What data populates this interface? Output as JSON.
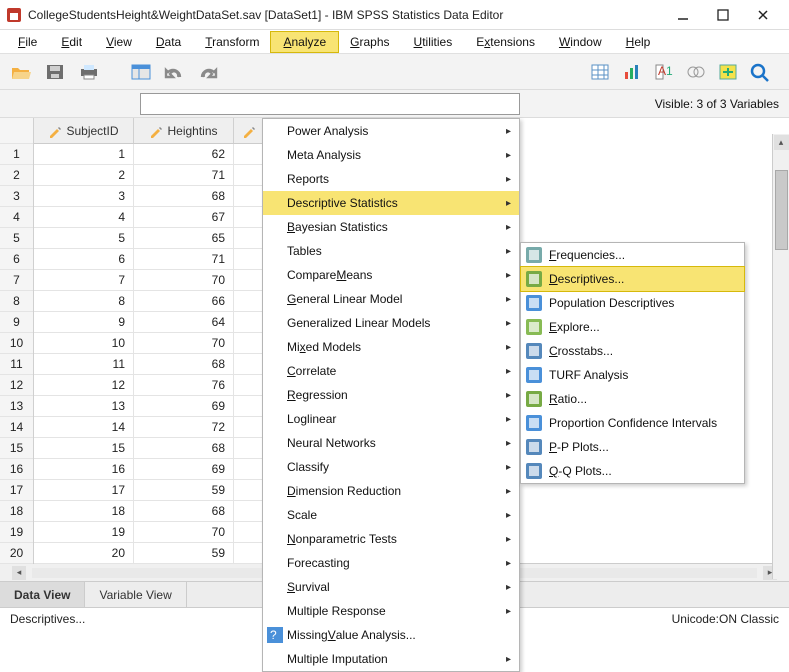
{
  "title": "CollegeStudentsHeight&WeightDataSet.sav [DataSet1] - IBM SPSS Statistics Data Editor",
  "menus": [
    "File",
    "Edit",
    "View",
    "Data",
    "Transform",
    "Analyze",
    "Graphs",
    "Utilities",
    "Extensions",
    "Window",
    "Help"
  ],
  "menu_ul": [
    "F",
    "E",
    "V",
    "D",
    "T",
    "A",
    "G",
    "U",
    "x",
    "W",
    "H"
  ],
  "visible_text": "Visible: 3 of 3 Variables",
  "columns": [
    "SubjectID",
    "Heightins"
  ],
  "data_rows": [
    [
      1,
      62
    ],
    [
      2,
      71
    ],
    [
      3,
      68
    ],
    [
      4,
      67
    ],
    [
      5,
      65
    ],
    [
      6,
      71
    ],
    [
      7,
      70
    ],
    [
      8,
      66
    ],
    [
      9,
      64
    ],
    [
      10,
      70
    ],
    [
      11,
      68
    ],
    [
      12,
      76
    ],
    [
      13,
      69
    ],
    [
      14,
      72
    ],
    [
      15,
      68
    ],
    [
      16,
      69
    ],
    [
      17,
      59
    ],
    [
      18,
      68
    ],
    [
      19,
      70
    ],
    [
      20,
      59
    ]
  ],
  "analyze_items": [
    {
      "label": "Power Analysis",
      "ul": "",
      "arrow": true
    },
    {
      "label": "Meta Analysis",
      "ul": "",
      "arrow": true
    },
    {
      "label": "Reports",
      "ul": "",
      "arrow": true
    },
    {
      "label": "Descriptive Statistics",
      "ul": "E",
      "arrow": true,
      "hl": true
    },
    {
      "label": "Bayesian Statistics",
      "ul": "B",
      "arrow": true
    },
    {
      "label": "Tables",
      "ul": "",
      "arrow": true
    },
    {
      "label": "Compare Means",
      "ul": "M",
      "arrow": true
    },
    {
      "label": "General Linear Model",
      "ul": "G",
      "arrow": true
    },
    {
      "label": "Generalized Linear Models",
      "ul": "",
      "arrow": true
    },
    {
      "label": "Mixed Models",
      "ul": "x",
      "arrow": true
    },
    {
      "label": "Correlate",
      "ul": "C",
      "arrow": true
    },
    {
      "label": "Regression",
      "ul": "R",
      "arrow": true
    },
    {
      "label": "Loglinear",
      "ul": "",
      "arrow": true
    },
    {
      "label": "Neural Networks",
      "ul": "",
      "arrow": true
    },
    {
      "label": "Classify",
      "ul": "",
      "arrow": true
    },
    {
      "label": "Dimension Reduction",
      "ul": "D",
      "arrow": true
    },
    {
      "label": "Scale",
      "ul": "A",
      "arrow": true
    },
    {
      "label": "Nonparametric Tests",
      "ul": "N",
      "arrow": true
    },
    {
      "label": "Forecasting",
      "ul": "T",
      "arrow": true
    },
    {
      "label": "Survival",
      "ul": "S",
      "arrow": true
    },
    {
      "label": "Multiple Response",
      "ul": "U",
      "arrow": true
    },
    {
      "label": "Missing Value Analysis...",
      "ul": "V",
      "arrow": false,
      "icon": true
    },
    {
      "label": "Multiple Imputation",
      "ul": "",
      "arrow": true
    }
  ],
  "submenu_items": [
    {
      "label": "Frequencies...",
      "ul": "F",
      "icon": "freq"
    },
    {
      "label": "Descriptives...",
      "ul": "D",
      "icon": "desc",
      "hl": true
    },
    {
      "label": "Population Descriptives",
      "ul": "",
      "icon": "plus"
    },
    {
      "label": "Explore...",
      "ul": "E",
      "icon": "explore"
    },
    {
      "label": "Crosstabs...",
      "ul": "C",
      "icon": "cross"
    },
    {
      "label": "TURF Analysis",
      "ul": "",
      "icon": "plus"
    },
    {
      "label": "Ratio...",
      "ul": "R",
      "icon": "ratio"
    },
    {
      "label": "Proportion Confidence Intervals",
      "ul": "",
      "icon": "plus"
    },
    {
      "label": "P-P Plots...",
      "ul": "P",
      "icon": "pp"
    },
    {
      "label": "Q-Q Plots...",
      "ul": "Q",
      "icon": "qq"
    }
  ],
  "tabs": {
    "data": "Data View",
    "var": "Variable View"
  },
  "status_left": "Descriptives...",
  "status_right": "Unicode:ON Classic"
}
